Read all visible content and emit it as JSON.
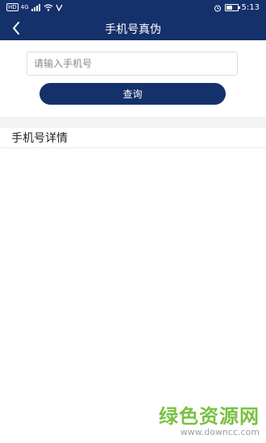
{
  "status_bar": {
    "left_badge": "HD",
    "network": "4G",
    "time": "5:13",
    "battery_level": 0.55,
    "icons": [
      "hd-icon",
      "signal-icon",
      "wifi-icon",
      "data-icon",
      "alarm-icon",
      "battery-icon"
    ]
  },
  "navbar": {
    "title": "手机号真伪",
    "back_icon": "chevron-left-icon"
  },
  "form": {
    "phone_placeholder": "请输入手机号",
    "phone_value": "",
    "query_label": "查询"
  },
  "details": {
    "header": "手机号详情"
  },
  "watermark": {
    "title": "绿色资源网",
    "url": "www.downcc.com"
  },
  "colors": {
    "primary": "#15316b",
    "watermark_green": "#7ac143"
  }
}
